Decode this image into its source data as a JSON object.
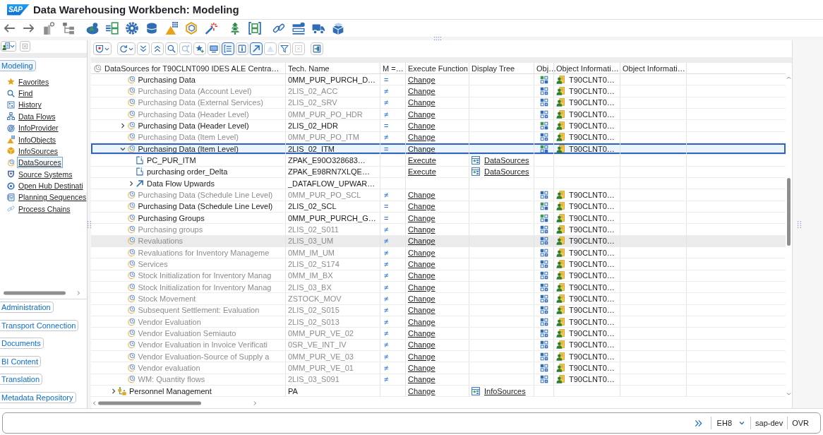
{
  "window": {
    "logo_text": "SAP",
    "title": "Data Warehousing Workbench: Modeling"
  },
  "navigator": {
    "sections": [
      {
        "label": "Modeling",
        "expanded": true,
        "items": [
          {
            "label": "Favorites",
            "selected": false
          },
          {
            "label": "Find",
            "selected": false
          },
          {
            "label": "History",
            "selected": false
          },
          {
            "label": "Data Flows",
            "selected": false
          },
          {
            "label": "InfoProvider",
            "selected": false
          },
          {
            "label": "InfoObjects",
            "selected": false
          },
          {
            "label": "InfoSources",
            "selected": false
          },
          {
            "label": "DataSources",
            "selected": true
          },
          {
            "label": "Source Systems",
            "selected": false
          },
          {
            "label": "Open Hub Destinati",
            "selected": false
          },
          {
            "label": "Planning Sequences",
            "selected": false
          },
          {
            "label": "Process Chains",
            "selected": false
          }
        ]
      },
      {
        "label": "Administration",
        "expanded": false
      },
      {
        "label": "Transport Connection",
        "expanded": false
      },
      {
        "label": "Documents",
        "expanded": false
      },
      {
        "label": "BI Content",
        "expanded": false
      },
      {
        "label": "Translation",
        "expanded": false
      },
      {
        "label": "Metadata Repository",
        "expanded": false
      }
    ]
  },
  "main_toolbar": [
    {
      "pressed": false,
      "disabled": false
    },
    {
      "pressed": false,
      "disabled": false
    },
    {
      "pressed": false,
      "disabled": false
    },
    {
      "pressed": false,
      "disabled": false
    },
    {
      "pressed": false,
      "disabled": false
    },
    {
      "pressed": false,
      "disabled": true
    },
    {
      "pressed": false,
      "disabled": false
    },
    {
      "pressed": false,
      "disabled": false
    },
    {
      "pressed": true,
      "disabled": false
    },
    {
      "pressed": false,
      "disabled": false
    },
    {
      "pressed": true,
      "disabled": false
    },
    {
      "pressed": false,
      "disabled": true
    },
    {
      "pressed": false,
      "disabled": false
    },
    {
      "pressed": false,
      "disabled": true
    },
    {
      "pressed": false,
      "disabled": false
    }
  ],
  "table": {
    "columns": [
      "DataSources for T90CLNT090 IDES ALE Centra…",
      "Tech. Name",
      "M =…",
      "Execute Function",
      "Display Tree",
      "Obj…",
      "Object Informati…",
      "Object Informati…"
    ],
    "rows": [
      {
        "children": [
          {
            "label": "Purchasing Data",
            "tech_name": "0MM_PUR_PURCH_D…",
            "m": "=",
            "execute_function": "Change",
            "object_info": "T90CLNT0…",
            "kind": "datasource",
            "active": true,
            "selected": false,
            "highlighted": false
          },
          {
            "label": "Purchasing Data (Account Level)",
            "tech_name": "2LIS_02_ACC",
            "m": "≠",
            "execute_function": "Change",
            "object_info": "T90CLNT0…",
            "kind": "datasource",
            "active": false,
            "selected": false,
            "highlighted": false
          },
          {
            "label": "Purchasing Data (External Services)",
            "tech_name": "2LIS_02_SRV",
            "m": "≠",
            "execute_function": "Change",
            "object_info": "T90CLNT0…",
            "kind": "datasource",
            "active": false,
            "selected": false,
            "highlighted": false
          },
          {
            "label": "Purchasing Data (Header Level)",
            "tech_name": "0MM_PUR_PO_HDR",
            "m": "≠",
            "execute_function": "Change",
            "object_info": "T90CLNT0…",
            "kind": "datasource",
            "active": false,
            "selected": false,
            "highlighted": false
          },
          {
            "label": "Purchasing Data (Header Level)",
            "tech_name": "2LIS_02_HDR",
            "m": "=",
            "execute_function": "Change",
            "object_info": "T90CLNT0…",
            "kind": "datasource",
            "active": true,
            "selected": false,
            "highlighted": false,
            "expanded": false
          },
          {
            "label": "Purchasing Data (Item Level)",
            "tech_name": "0MM_PUR_PO_ITM",
            "m": "≠",
            "execute_function": "Change",
            "object_info": "T90CLNT0…",
            "kind": "datasource",
            "active": false,
            "selected": false,
            "highlighted": false
          },
          {
            "label": "Purchasing Data (Item Level)",
            "tech_name": "2LIS_02_ITM",
            "m": "=",
            "execute_function": "Change",
            "object_info": "T90CLNT0…",
            "kind": "datasource",
            "active": true,
            "selected": true,
            "highlighted": false,
            "expanded": true,
            "children": [
              {
                "label": "PC_PUR_ITM",
                "tech_name": "ZPAK_E90O328683…",
                "execute_function": "Execute",
                "display_tree": "DataSources",
                "kind": "infopackage",
                "active": true,
                "selected": false,
                "highlighted": false
              },
              {
                "label": "purchasing order_Delta",
                "tech_name": "ZPAK_E98RN7XLQE…",
                "execute_function": "Execute",
                "display_tree": "DataSources",
                "kind": "infopackage",
                "active": true,
                "selected": false,
                "highlighted": false
              },
              {
                "label": "Data Flow Upwards",
                "tech_name": "_DATAFLOW_UPWAR…",
                "kind": "dataflow",
                "active": true,
                "selected": false,
                "highlighted": false,
                "expanded": false
              }
            ]
          },
          {
            "label": "Purchasing Data (Schedule Line Level)",
            "tech_name": "0MM_PUR_PO_SCL",
            "m": "≠",
            "execute_function": "Change",
            "object_info": "T90CLNT0…",
            "kind": "datasource",
            "active": false,
            "selected": false,
            "highlighted": false
          },
          {
            "label": "Purchasing Data (Schedule Line Level)",
            "tech_name": "2LIS_02_SCL",
            "m": "=",
            "execute_function": "Change",
            "object_info": "T90CLNT0…",
            "kind": "datasource",
            "active": true,
            "selected": false,
            "highlighted": false
          },
          {
            "label": "Purchasing Groups",
            "tech_name": "0MM_PUR_PURCH_G…",
            "m": "=",
            "execute_function": "Change",
            "object_info": "T90CLNT0…",
            "kind": "datasource",
            "active": true,
            "selected": false,
            "highlighted": false
          },
          {
            "label": "Purchasing groups",
            "tech_name": "2LIS_02_S011",
            "m": "≠",
            "execute_function": "Change",
            "object_info": "T90CLNT0…",
            "kind": "datasource",
            "active": false,
            "selected": false,
            "highlighted": false
          },
          {
            "label": "Revaluations",
            "tech_name": "2LIS_03_UM",
            "m": "≠",
            "execute_function": "Change",
            "object_info": "T90CLNT0…",
            "kind": "datasource",
            "active": false,
            "selected": false,
            "highlighted": true
          },
          {
            "label": "Revaluations for Inventory Manageme",
            "tech_name": "0MM_IM_UM",
            "m": "≠",
            "execute_function": "Change",
            "object_info": "T90CLNT0…",
            "kind": "datasource",
            "active": false,
            "selected": false,
            "highlighted": false
          },
          {
            "label": "Services",
            "tech_name": "2LIS_02_S174",
            "m": "≠",
            "execute_function": "Change",
            "object_info": "T90CLNT0…",
            "kind": "datasource",
            "active": false,
            "selected": false,
            "highlighted": false
          },
          {
            "label": "Stock Initialization for Inventory Manag",
            "tech_name": "0MM_IM_BX",
            "m": "≠",
            "execute_function": "Change",
            "object_info": "T90CLNT0…",
            "kind": "datasource",
            "active": false,
            "selected": false,
            "highlighted": false
          },
          {
            "label": "Stock Initialization for Inventory Manag",
            "tech_name": "2LIS_03_BX",
            "m": "≠",
            "execute_function": "Change",
            "object_info": "T90CLNT0…",
            "kind": "datasource",
            "active": false,
            "selected": false,
            "highlighted": false
          },
          {
            "label": "Stock Movement",
            "tech_name": "ZSTOCK_MOV",
            "m": "≠",
            "execute_function": "Change",
            "object_info": "T90CLNT0…",
            "kind": "datasource",
            "active": false,
            "selected": false,
            "highlighted": false
          },
          {
            "label": "Subsequent Settlement: Evaluation",
            "tech_name": "2LIS_02_S015",
            "m": "≠",
            "execute_function": "Change",
            "object_info": "T90CLNT0…",
            "kind": "datasource",
            "active": false,
            "selected": false,
            "highlighted": false
          },
          {
            "label": "Vendor Evaluation",
            "tech_name": "2LIS_02_S013",
            "m": "≠",
            "execute_function": "Change",
            "object_info": "T90CLNT0…",
            "kind": "datasource",
            "active": false,
            "selected": false,
            "highlighted": false
          },
          {
            "label": "Vendor Evaluation Semiauto",
            "tech_name": "0MM_PUR_VE_02",
            "m": "≠",
            "execute_function": "Change",
            "object_info": "T90CLNT0…",
            "kind": "datasource",
            "active": false,
            "selected": false,
            "highlighted": false
          },
          {
            "label": "Vendor Evaluation in Invoice Verificati",
            "tech_name": "0SR_VE_INT_IV",
            "m": "≠",
            "execute_function": "Change",
            "object_info": "T90CLNT0…",
            "kind": "datasource",
            "active": false,
            "selected": false,
            "highlighted": false
          },
          {
            "label": "Vendor Evaluation-Source of Supply a",
            "tech_name": "0MM_PUR_VE_03",
            "m": "≠",
            "execute_function": "Change",
            "object_info": "T90CLNT0…",
            "kind": "datasource",
            "active": false,
            "selected": false,
            "highlighted": false
          },
          {
            "label": "Vendor evaluation",
            "tech_name": "0MM_PUR_VE_01",
            "m": "≠",
            "execute_function": "Change",
            "object_info": "T90CLNT0…",
            "kind": "datasource",
            "active": false,
            "selected": false,
            "highlighted": false
          },
          {
            "label": "WM: Quantity flows",
            "tech_name": "2LIS_03_S091",
            "m": "≠",
            "execute_function": "Change",
            "object_info": "T90CLNT0…",
            "kind": "datasource",
            "active": false,
            "selected": false,
            "highlighted": false
          }
        ]
      },
      {
        "label": "Personnel Management",
        "tech_name": "PA",
        "execute_function": "Change",
        "display_tree": "InfoSources",
        "kind": "application_component",
        "active": true,
        "selected": false,
        "highlighted": false,
        "expanded": false
      }
    ]
  },
  "status_bar": {
    "system": "EH8",
    "server": "sap-dev",
    "mode": "OVR"
  }
}
